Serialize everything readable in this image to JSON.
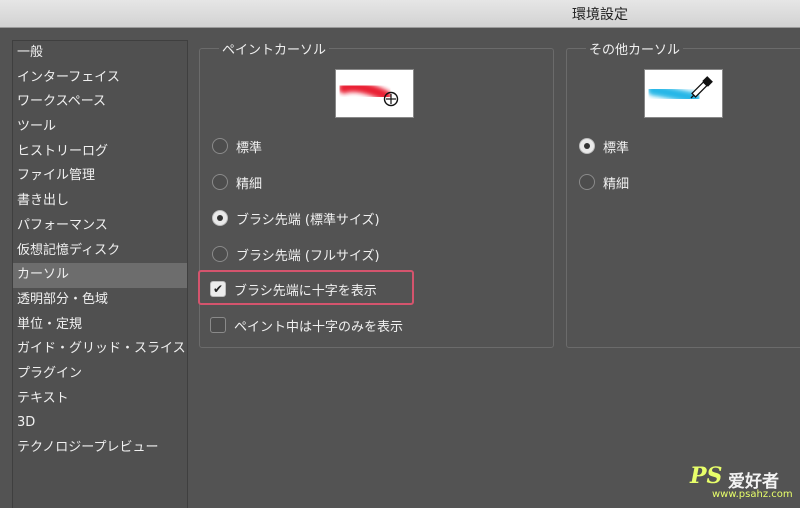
{
  "window": {
    "title": "環境設定"
  },
  "sidebar": {
    "items": [
      {
        "label": "一般"
      },
      {
        "label": "インターフェイス"
      },
      {
        "label": "ワークスペース"
      },
      {
        "label": "ツール"
      },
      {
        "label": "ヒストリーログ"
      },
      {
        "label": "ファイル管理"
      },
      {
        "label": "書き出し"
      },
      {
        "label": "パフォーマンス"
      },
      {
        "label": "仮想記憶ディスク"
      },
      {
        "label": "カーソル",
        "selected": true
      },
      {
        "label": "透明部分・色域"
      },
      {
        "label": "単位・定規"
      },
      {
        "label": "ガイド・グリッド・スライス"
      },
      {
        "label": "プラグイン"
      },
      {
        "label": "テキスト"
      },
      {
        "label": "3D"
      },
      {
        "label": "テクノロジープレビュー"
      }
    ]
  },
  "paint_cursor": {
    "legend": "ペイントカーソル",
    "options": [
      {
        "label": "標準",
        "selected": false
      },
      {
        "label": "精細",
        "selected": false
      },
      {
        "label": "ブラシ先端 (標準サイズ)",
        "selected": true
      },
      {
        "label": "ブラシ先端 (フルサイズ)",
        "selected": false
      }
    ],
    "checkboxes": [
      {
        "label": "ブラシ先端に十字を表示",
        "checked": true
      },
      {
        "label": "ペイント中は十字のみを表示",
        "checked": false
      }
    ],
    "preview_color": "#e8142b"
  },
  "other_cursor": {
    "legend": "その他カーソル",
    "options": [
      {
        "label": "標準",
        "selected": true
      },
      {
        "label": "精細",
        "selected": false
      }
    ],
    "preview_color": "#1fb4e6"
  },
  "watermark": {
    "brand": "PS",
    "cn": "爱好者",
    "url": "www.psahz.com"
  },
  "colors": {
    "highlight": "#d4546d",
    "panel_bg": "#535353"
  }
}
